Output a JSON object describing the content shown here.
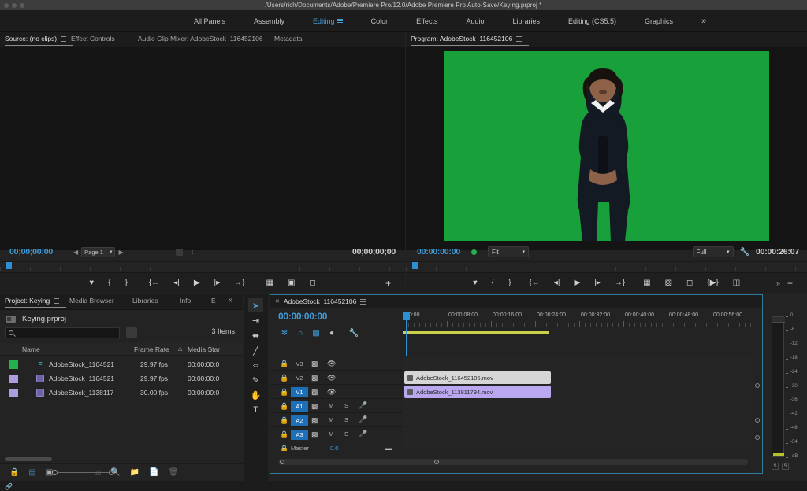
{
  "titlebar": {
    "path": "/Users/rich/Documents/Adobe/Premiere Pro/12.0/Adobe Premiere Pro Auto-Save/Keying.prproj *"
  },
  "workspace": {
    "items": [
      {
        "label": "All Panels",
        "active": false
      },
      {
        "label": "Assembly",
        "active": false
      },
      {
        "label": "Editing",
        "active": true
      },
      {
        "label": "Color",
        "active": false
      },
      {
        "label": "Effects",
        "active": false
      },
      {
        "label": "Audio",
        "active": false
      },
      {
        "label": "Libraries",
        "active": false
      },
      {
        "label": "Editing (CS5.5)",
        "active": false
      },
      {
        "label": "Graphics",
        "active": false
      }
    ],
    "overflow": "»"
  },
  "source_panel": {
    "tabs": [
      {
        "label": "Source: (no clips)",
        "active": true
      },
      {
        "label": "Effect Controls",
        "active": false
      },
      {
        "label": "Audio Clip Mixer: AdobeStock_116452106",
        "active": false
      },
      {
        "label": "Metadata",
        "active": false
      }
    ],
    "current_timecode": "00;00;00;00",
    "duration_timecode": "00;00;00;00",
    "page_select": "Page 1",
    "transport": [
      "marker",
      "mark-in",
      "mark-out",
      "go-to-in",
      "step-back",
      "play",
      "step-forward",
      "go-to-out",
      "insert",
      "overwrite",
      "export-frame"
    ],
    "add_button": "+"
  },
  "program_panel": {
    "tabs": [
      {
        "label": "Program: AdobeStock_116452106",
        "active": true
      }
    ],
    "current_timecode": "00:00:00:00",
    "duration_timecode": "00:00:26:07",
    "zoom_level": "Fit",
    "resolution": "Full",
    "transport": [
      "marker",
      "mark-in",
      "mark-out",
      "go-to-in",
      "step-back",
      "play",
      "step-forward",
      "go-to-out",
      "lift",
      "extract",
      "export-frame",
      "safe-margins",
      "multicam"
    ],
    "overflow": "»",
    "add_button": "+",
    "green_screen_color": "#18a03a"
  },
  "project_panel": {
    "tabs": [
      {
        "label": "Project: Keying",
        "active": true
      },
      {
        "label": "Media Browser",
        "active": false
      },
      {
        "label": "Libraries",
        "active": false
      },
      {
        "label": "Info",
        "active": false
      },
      {
        "label": "E",
        "active": false
      }
    ],
    "overflow": "»",
    "project_file": "Keying.prproj",
    "search_placeholder": "",
    "item_count": "3 Items",
    "columns": [
      "Name",
      "Frame Rate",
      "Media Star"
    ],
    "sort_column": "Frame Rate",
    "rows": [
      {
        "name": "AdobeStock_1164521",
        "frame_rate": "29.97 fps",
        "media_start": "00:00:00:0",
        "swatch": "#22b14c",
        "kind": "sequence"
      },
      {
        "name": "AdobeStock_1164521",
        "frame_rate": "29.97 fps",
        "media_start": "00:00:00:0",
        "swatch": "#ab9de0",
        "kind": "clip"
      },
      {
        "name": "AdobeStock_1138117",
        "frame_rate": "30.00 fps",
        "media_start": "00:00:00:0",
        "swatch": "#ab9de0",
        "kind": "clip"
      }
    ]
  },
  "tools": [
    {
      "name": "selection-tool",
      "glyph": "➤",
      "active": true
    },
    {
      "name": "track-select-forward-tool",
      "glyph": "⇥",
      "active": false
    },
    {
      "name": "ripple-edit-tool",
      "glyph": "⬌",
      "active": false
    },
    {
      "name": "razor-tool",
      "glyph": "╱",
      "active": false
    },
    {
      "name": "slip-tool",
      "glyph": "⇔",
      "active": false
    },
    {
      "name": "pen-tool",
      "glyph": "✎",
      "active": false
    },
    {
      "name": "hand-tool",
      "glyph": "✋",
      "active": false
    },
    {
      "name": "type-tool",
      "glyph": "T",
      "active": false
    }
  ],
  "timeline": {
    "tab_label": "AdobeStock_116452106",
    "playhead_timecode": "00:00:00:00",
    "tool_buttons": [
      "sequence-settings",
      "snap",
      "linked-selection",
      "add-marker",
      "timeline-display-settings"
    ],
    "ruler_labels": [
      ":00:00",
      "00:00:08:00",
      "00:00:16:00",
      "00:00:24:00",
      "00:00:32:00",
      "00:00:40:00",
      "00:00:48:00",
      "00:00:56:00"
    ],
    "tracks": [
      {
        "name": "V3",
        "targeted": false,
        "type": "video"
      },
      {
        "name": "V2",
        "targeted": false,
        "type": "video"
      },
      {
        "name": "V1",
        "targeted": true,
        "type": "video"
      },
      {
        "name": "A1",
        "targeted": true,
        "type": "audio"
      },
      {
        "name": "A2",
        "targeted": true,
        "type": "audio"
      },
      {
        "name": "A3",
        "targeted": true,
        "type": "audio"
      }
    ],
    "master_label": "Master",
    "master_value": "0.0",
    "audio_track_buttons": {
      "mute": "M",
      "solo": "S",
      "record": "mic-icon"
    },
    "clips": [
      {
        "label": "AdobeStock_116452106.mov",
        "track": "V2",
        "color": "#d6d6d6",
        "text_color": "#2a2a2a"
      },
      {
        "label": "AdobeStock_113811794.mov",
        "track": "V1",
        "color": "#b9a7ef",
        "text_color": "#2a2a2a"
      }
    ]
  },
  "meters": {
    "scale_labels": [
      "0",
      "-6",
      "-12",
      "-18",
      "-24",
      "-30",
      "-36",
      "-42",
      "-48",
      "-54",
      "-dB"
    ],
    "solo_buttons": [
      "S",
      "S"
    ],
    "level_color": "#b5c22e"
  }
}
